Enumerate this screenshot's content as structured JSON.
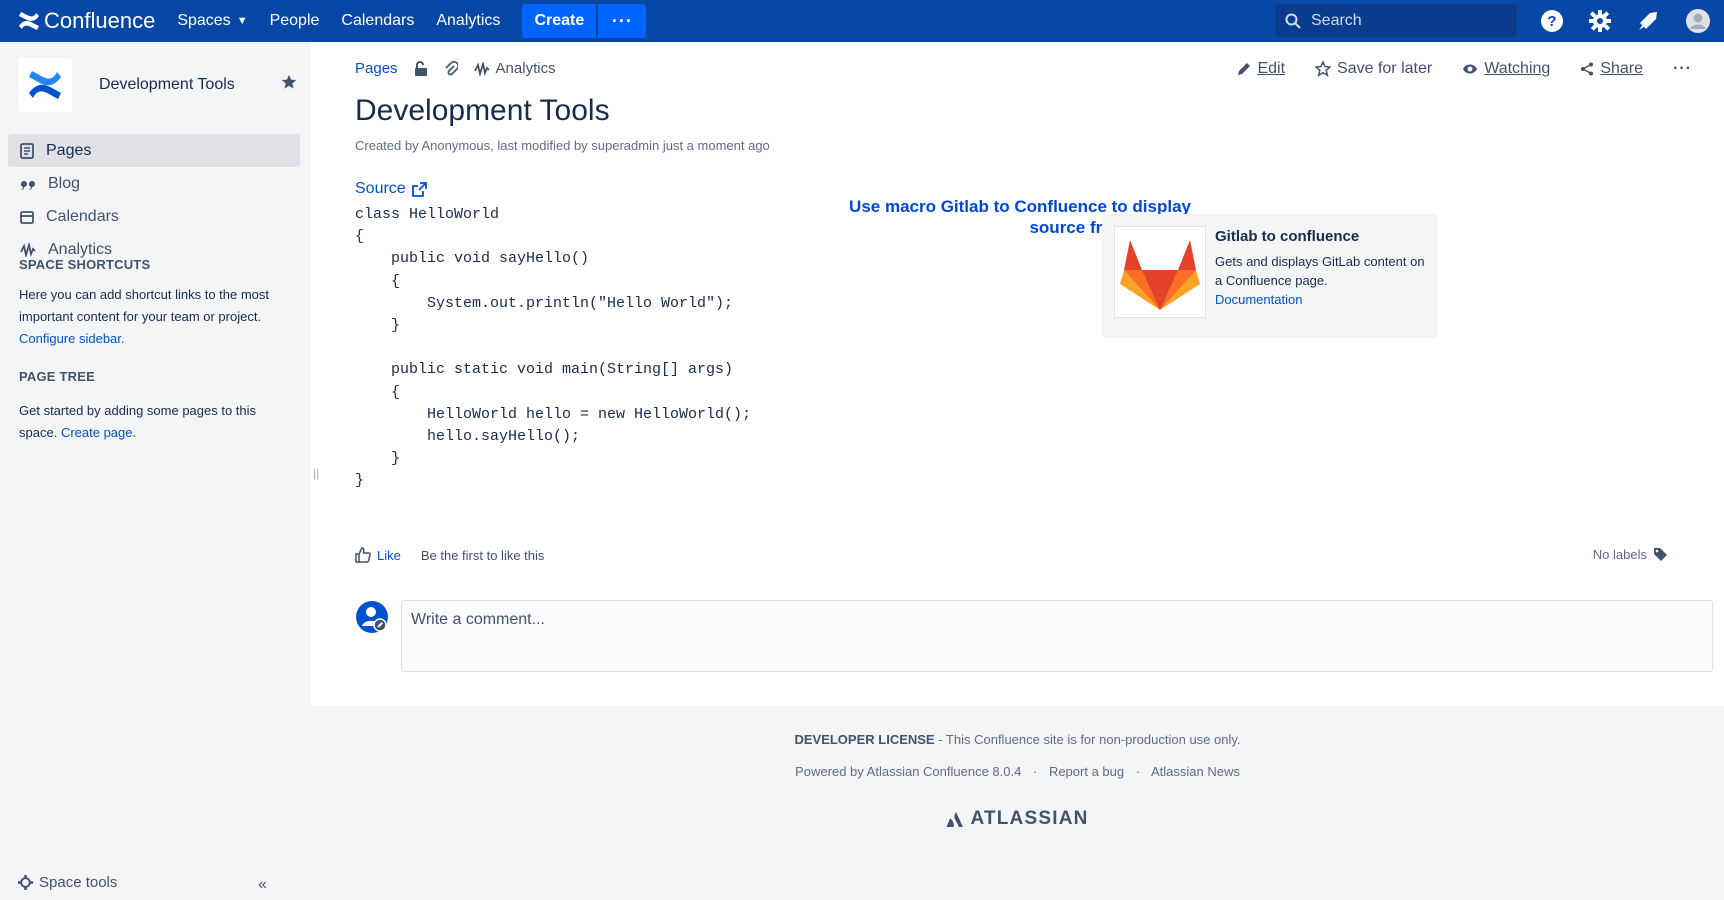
{
  "topnav": {
    "product": "Confluence",
    "spaces_label": "Spaces",
    "people_label": "People",
    "calendars_label": "Calendars",
    "analytics_label": "Analytics",
    "create_label": "Create",
    "more_label": "···",
    "search_placeholder": "Search",
    "icons": [
      "help-icon",
      "settings-icon",
      "notifications-icon",
      "user-avatar-icon"
    ]
  },
  "sidebar": {
    "space_name": "Development Tools",
    "items": [
      {
        "label": "Pages",
        "icon": "pages-icon",
        "active": true
      },
      {
        "label": "Blog",
        "icon": "quote-icon",
        "active": false
      },
      {
        "label": "Calendars",
        "icon": "calendar-icon",
        "active": false
      },
      {
        "label": "Analytics",
        "icon": "analytics-icon",
        "active": false
      }
    ],
    "shortcuts_heading": "SPACE SHORTCUTS",
    "shortcuts_text": "Here you can add shortcut links to the most important content for your team or project.",
    "shortcuts_link": "Configure sidebar",
    "page_tree_heading": "PAGE TREE",
    "page_tree_text": "Get started by adding some pages to this space.",
    "page_tree_link": "Create page",
    "space_tools_label": "Space tools",
    "collapse_label": "«"
  },
  "page": {
    "breadcrumb_pages": "Pages",
    "breadcrumb_analytics": "Analytics",
    "actions": {
      "edit": "Edit",
      "save_for_later": "Save for later",
      "watching": "Watching",
      "share": "Share",
      "more": "···"
    },
    "title": "Development Tools",
    "byline": "Created by Anonymous, last modified by superadmin just a moment ago",
    "source_label": "Source",
    "code": "class HelloWorld\n{\n    public void sayHello()\n    {\n        System.out.println(\"Hello World\");\n    }\n\n    public static void main(String[] args)\n    {\n        HelloWorld hello = new HelloWorld();\n        hello.sayHello();\n    }\n}",
    "annotation": "Use macro Gitlab to Confluence to display source from GitLab.",
    "macro": {
      "title": "Gitlab to confluence",
      "description": "Gets and displays GitLab content on a Confluence page.",
      "link": "Documentation"
    },
    "like_label": "Like",
    "like_text": "Be the first to like this",
    "labels_text": "No labels",
    "comment_placeholder": "Write a comment..."
  },
  "footer": {
    "license_bold": "DEVELOPER LICENSE",
    "license_rest": " - This Confluence site is for non-production use only.",
    "powered_by": "Powered by Atlassian Confluence 8.0.4",
    "report_bug": "Report a bug",
    "news": "Atlassian News",
    "separator": "·",
    "brand": "ATLASSIAN"
  },
  "colors": {
    "nav_bg": "#0747a6",
    "create_bg": "#0065ff",
    "link": "#0052cc",
    "annotation": "#0047e0",
    "sidebar_bg": "#f4f5f7"
  }
}
